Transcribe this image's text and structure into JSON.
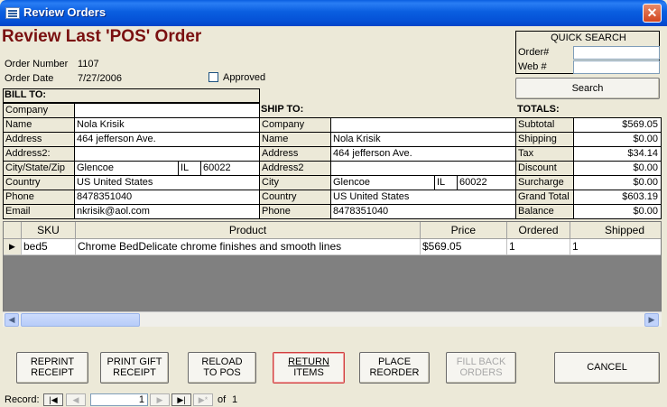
{
  "window": {
    "title": "Review Orders",
    "close_glyph": "✕"
  },
  "header": {
    "title": "Review Last 'POS' Order",
    "order_number_label": "Order Number",
    "order_number": "1107",
    "order_date_label": "Order Date",
    "order_date": "7/27/2006",
    "approved_label": "Approved"
  },
  "quick_search": {
    "title": "QUICK SEARCH",
    "order_label": "Order#",
    "web_label": "Web #",
    "search_button": "Search"
  },
  "bill_to": {
    "heading": "BILL TO:",
    "company_label": "Company",
    "company": "",
    "name_label": "Name",
    "name": "Nola Krisik",
    "address_label": "Address",
    "address": "464 jefferson Ave.",
    "address2_label": "Address2:",
    "address2": "",
    "csz_label": "City/State/Zip",
    "city": "Glencoe",
    "state": "IL",
    "zip": "60022",
    "country_label": "Country",
    "country": "US United States",
    "phone_label": "Phone",
    "phone": "8478351040",
    "email_label": "Email",
    "email": "nkrisik@aol.com"
  },
  "ship_to": {
    "heading": "SHIP TO:",
    "company_label": "Company",
    "company": "",
    "name_label": "Name",
    "name": "Nola Krisik",
    "address_label": "Address",
    "address": "464 jefferson Ave.",
    "address2_label": "Address2",
    "address2": "",
    "city_label": "City",
    "city": "Glencoe",
    "state": "IL",
    "zip": "60022",
    "country_label": "Country",
    "country": "US United States",
    "phone_label": "Phone",
    "phone": "8478351040"
  },
  "totals": {
    "heading": "TOTALS:",
    "subtotal_label": "Subtotal",
    "subtotal": "$569.05",
    "shipping_label": "Shipping",
    "shipping": "$0.00",
    "tax_label": "Tax",
    "tax": "$34.14",
    "discount_label": "Discount",
    "discount": "$0.00",
    "surcharge_label": "Surcharge",
    "surcharge": "$0.00",
    "grand_total_label": "Grand Total",
    "grand_total": "$603.19",
    "balance_label": "Balance",
    "balance": "$0.00"
  },
  "items": {
    "columns": {
      "sku": "SKU",
      "product": "Product",
      "price": "Price",
      "ordered": "Ordered",
      "shipped": "Shipped"
    },
    "rows": [
      {
        "sku": "bed5",
        "product": "Chrome BedDelicate chrome finishes and smooth lines",
        "price": "$569.05",
        "ordered": "1",
        "shipped": "1"
      }
    ],
    "row_selector_glyph": "▶",
    "scroll_left_glyph": "◀",
    "scroll_right_glyph": "▶"
  },
  "buttons": {
    "reprint_1": "REPRINT",
    "reprint_2": "RECEIPT",
    "gift_1": "PRINT GIFT",
    "gift_2": "RECEIPT",
    "reload_1": "RELOAD",
    "reload_2": "TO POS",
    "return_1": "RETURN",
    "return_2": "ITEMS",
    "place_1": "PLACE",
    "place_2": "REORDER",
    "fill_1": "FILL BACK",
    "fill_2": "ORDERS",
    "cancel": "CANCEL"
  },
  "record_nav": {
    "label": "Record:",
    "first_glyph": "|◀",
    "prev_glyph": "◀",
    "current": "1",
    "next_glyph": "▶",
    "last_glyph": "▶|",
    "new_glyph": "▶*",
    "of_label": "of",
    "total": "1"
  },
  "colors": {
    "title_red": "#7a1010",
    "titlebar_blue": "#0a5ee0",
    "return_border": "#d04040"
  }
}
